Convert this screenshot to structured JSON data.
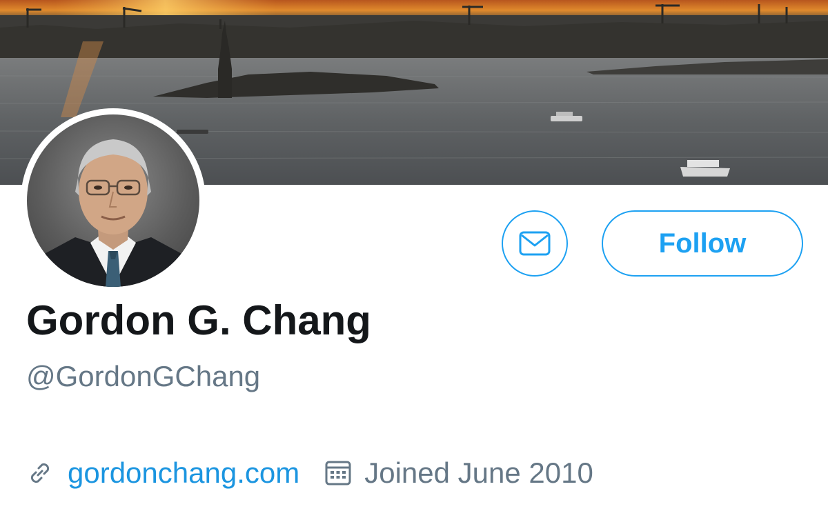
{
  "profile": {
    "display_name": "Gordon G. Chang",
    "handle": "@GordonGChang",
    "website": "gordonchang.com",
    "joined": "Joined June 2010"
  },
  "actions": {
    "follow_label": "Follow",
    "message_icon": "envelope-icon"
  },
  "meta_icons": {
    "website": "link-icon",
    "joined": "calendar-icon"
  },
  "colors": {
    "accent": "#1da1f2",
    "link": "#1b95e0",
    "name": "#14171a",
    "secondary": "#657786"
  }
}
